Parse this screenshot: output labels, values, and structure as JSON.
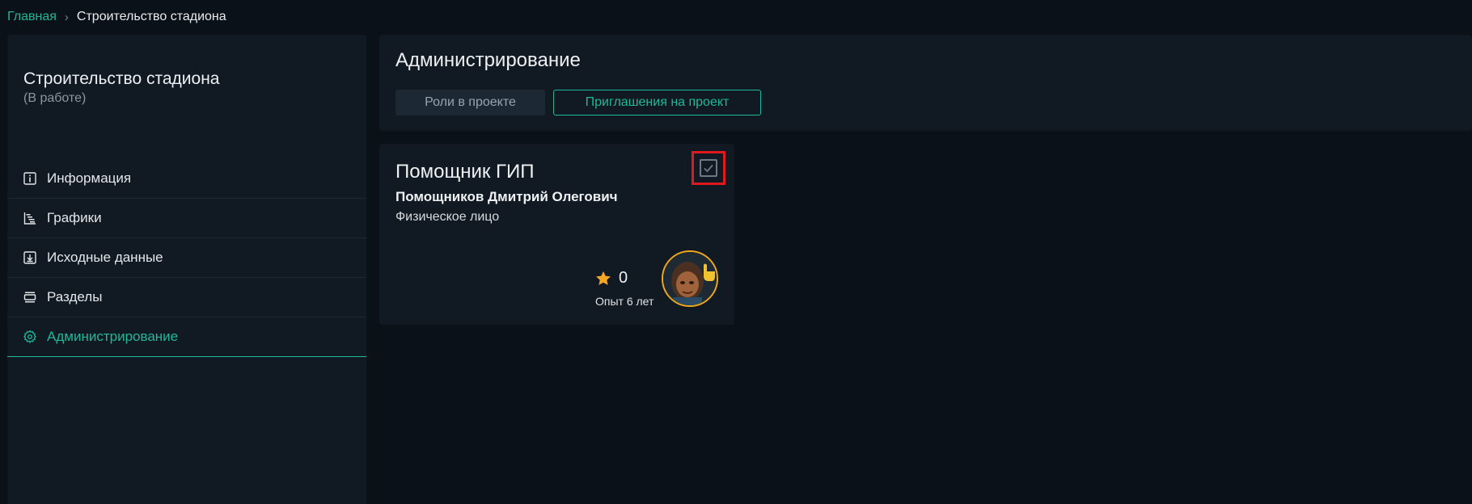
{
  "breadcrumb": {
    "home": "Главная",
    "separator": "›",
    "current": "Строительство стадиона"
  },
  "sidebar": {
    "project_title": "Строительство стадиона",
    "project_status": "(В работе)",
    "items": [
      {
        "label": "Информация",
        "icon": "info-icon"
      },
      {
        "label": "Графики",
        "icon": "gantt-icon"
      },
      {
        "label": "Исходные данные",
        "icon": "download-icon"
      },
      {
        "label": "Разделы",
        "icon": "sections-icon"
      },
      {
        "label": "Администрирование",
        "icon": "gear-icon",
        "active": true
      }
    ]
  },
  "admin": {
    "title": "Администрирование",
    "tabs": [
      {
        "label": "Роли в проекте"
      },
      {
        "label": "Приглашения на проект",
        "active": true
      }
    ]
  },
  "card": {
    "role": "Помощник ГИП",
    "name": "Помощников Дмитрий Олегович",
    "person_type": "Физическое лицо",
    "checked": true,
    "rating": "0",
    "experience": "Опыт 6 лет",
    "avatar_icon": "user-avatar"
  },
  "colors": {
    "accent": "#1fb89a",
    "background": "#0b1118",
    "panel": "#111a22",
    "star": "#f5a623",
    "highlight": "#e0191e"
  }
}
